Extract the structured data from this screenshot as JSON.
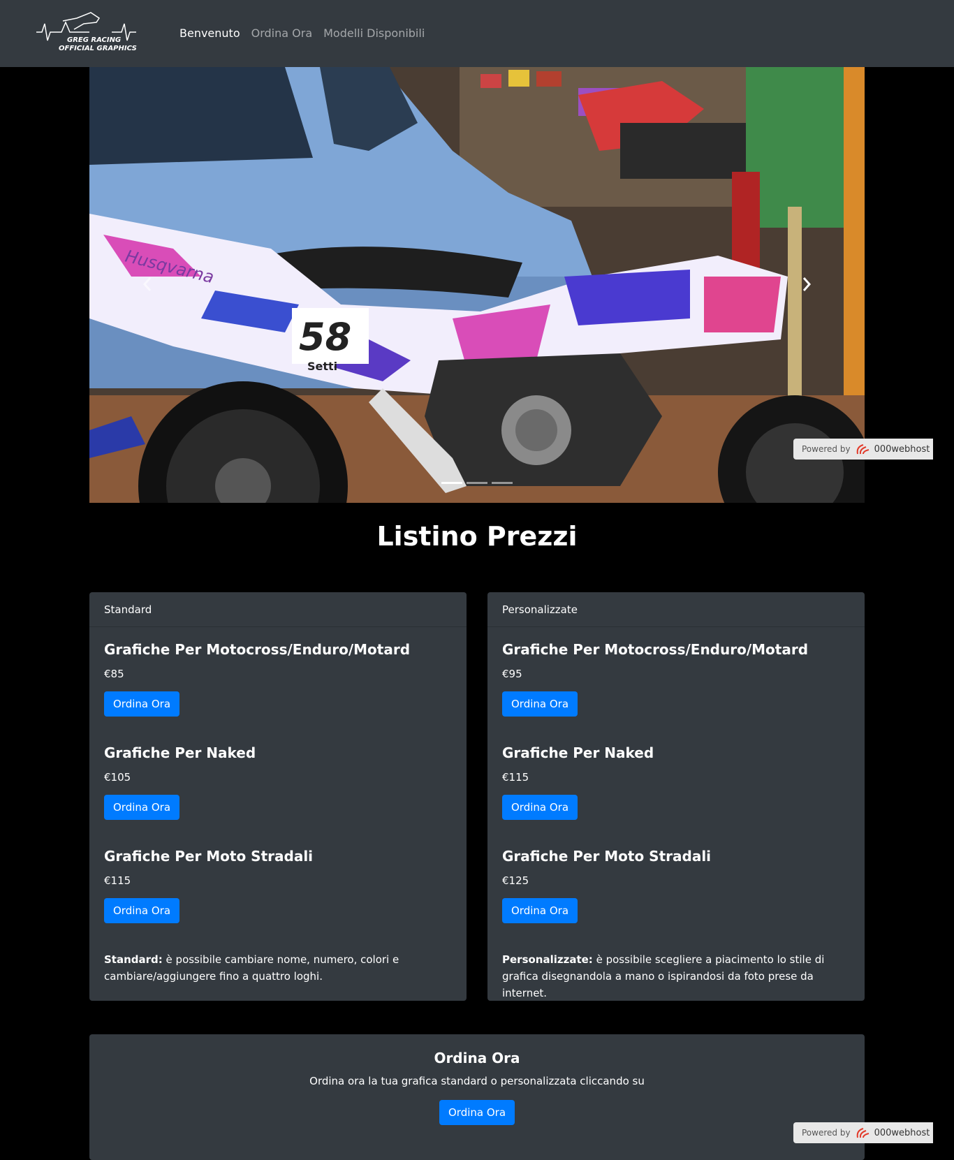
{
  "navbar": {
    "logo_alt": "Greg Racing Official Graphics",
    "links": [
      "Benvenuto",
      "Ordina Ora",
      "Modelli Disponibili"
    ]
  },
  "carousel": {
    "prev_icon": "chevron-left-icon",
    "next_icon": "chevron-right-icon",
    "slide_count": 3,
    "active_index": 0,
    "bike_number": "58",
    "bike_name": "Setti",
    "brand_text": "Husqvarna"
  },
  "powered": {
    "label": "Powered by",
    "brand": "000webhost"
  },
  "pricing": {
    "title": "Listino Prezzi",
    "standard": {
      "header": "Standard",
      "plans": [
        {
          "title": "Grafiche Per Motocross/Enduro/Motard",
          "price": "€85",
          "button": "Ordina Ora"
        },
        {
          "title": "Grafiche Per Naked",
          "price": "€105",
          "button": "Ordina Ora"
        },
        {
          "title": "Grafiche Per Moto Stradali",
          "price": "€115",
          "button": "Ordina Ora"
        }
      ],
      "note_label": "Standard:",
      "note_text": " è possibile cambiare nome, numero, colori e cambiare/aggiungere fino a quattro loghi."
    },
    "custom": {
      "header": "Personalizzate",
      "plans": [
        {
          "title": "Grafiche Per Motocross/Enduro/Motard",
          "price": "€95",
          "button": "Ordina Ora"
        },
        {
          "title": "Grafiche Per Naked",
          "price": "€115",
          "button": "Ordina Ora"
        },
        {
          "title": "Grafiche Per Moto Stradali",
          "price": "€125",
          "button": "Ordina Ora"
        }
      ],
      "note_label": "Personalizzate:",
      "note_text": " è possibile scegliere a piacimento lo stile di grafica disegnandola a mano o ispirandosi da foto prese da internet."
    }
  },
  "order": {
    "title": "Ordina Ora",
    "text": "Ordina ora la tua grafica standard o personalizzata cliccando su",
    "button": "Ordina Ora"
  },
  "colors": {
    "navbar": "#343a40",
    "card": "#343a40",
    "primary": "#007bff",
    "background": "#000000"
  }
}
